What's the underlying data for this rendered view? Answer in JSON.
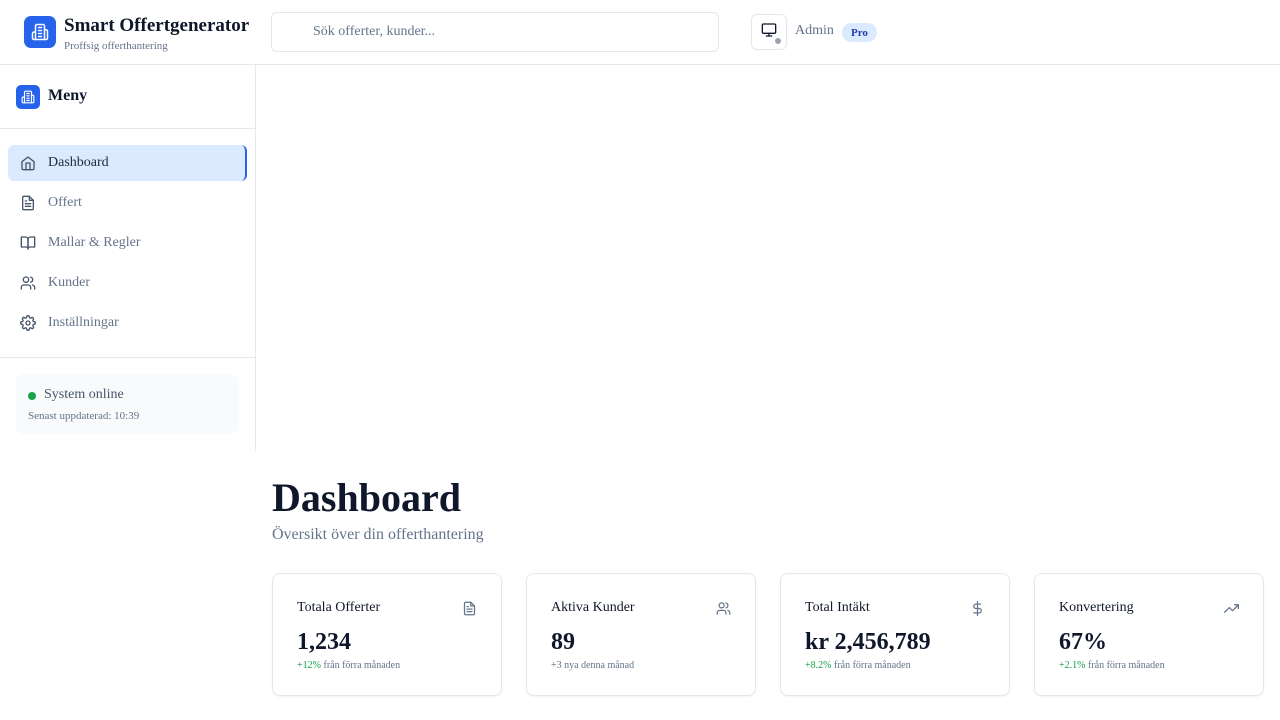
{
  "header": {
    "brand_title": "Smart Offertgenerator",
    "brand_subtitle": "Proffsig offerthantering",
    "search_placeholder": "Sök offerter, kunder...",
    "user_name": "Admin",
    "badge": "Pro"
  },
  "sidebar": {
    "title": "Meny",
    "items": [
      {
        "label": "Dashboard",
        "icon": "home-icon",
        "active": true
      },
      {
        "label": "Offert",
        "icon": "document-icon",
        "active": false
      },
      {
        "label": "Mallar & Regler",
        "icon": "book-icon",
        "active": false
      },
      {
        "label": "Kunder",
        "icon": "users-icon",
        "active": false
      },
      {
        "label": "Inställningar",
        "icon": "gear-icon",
        "active": false
      }
    ],
    "status": {
      "label": "System online",
      "updated": "Senast uppdaterad: 10:39"
    }
  },
  "main": {
    "title": "Dashboard",
    "subtitle": "Översikt över din offerthantering",
    "cards": [
      {
        "title": "Totala Offerter",
        "icon": "document-icon",
        "value": "1,234",
        "delta_up": "+12%",
        "delta_text": " från förra månaden"
      },
      {
        "title": "Aktiva Kunder",
        "icon": "users-icon",
        "value": "89",
        "delta_up": "",
        "delta_text": "+3 nya denna månad"
      },
      {
        "title": "Total Intäkt",
        "icon": "dollar-icon",
        "value": "kr 2,456,789",
        "delta_up": "+8.2%",
        "delta_text": " från förra månaden"
      },
      {
        "title": "Konvertering",
        "icon": "trending-up-icon",
        "value": "67%",
        "delta_up": "+2.1%",
        "delta_text": " från förra månaden"
      }
    ]
  },
  "colors": {
    "accent": "#2563eb",
    "active_bg": "#dbeafe",
    "online": "#16a34a",
    "positive": "#16a34a"
  }
}
